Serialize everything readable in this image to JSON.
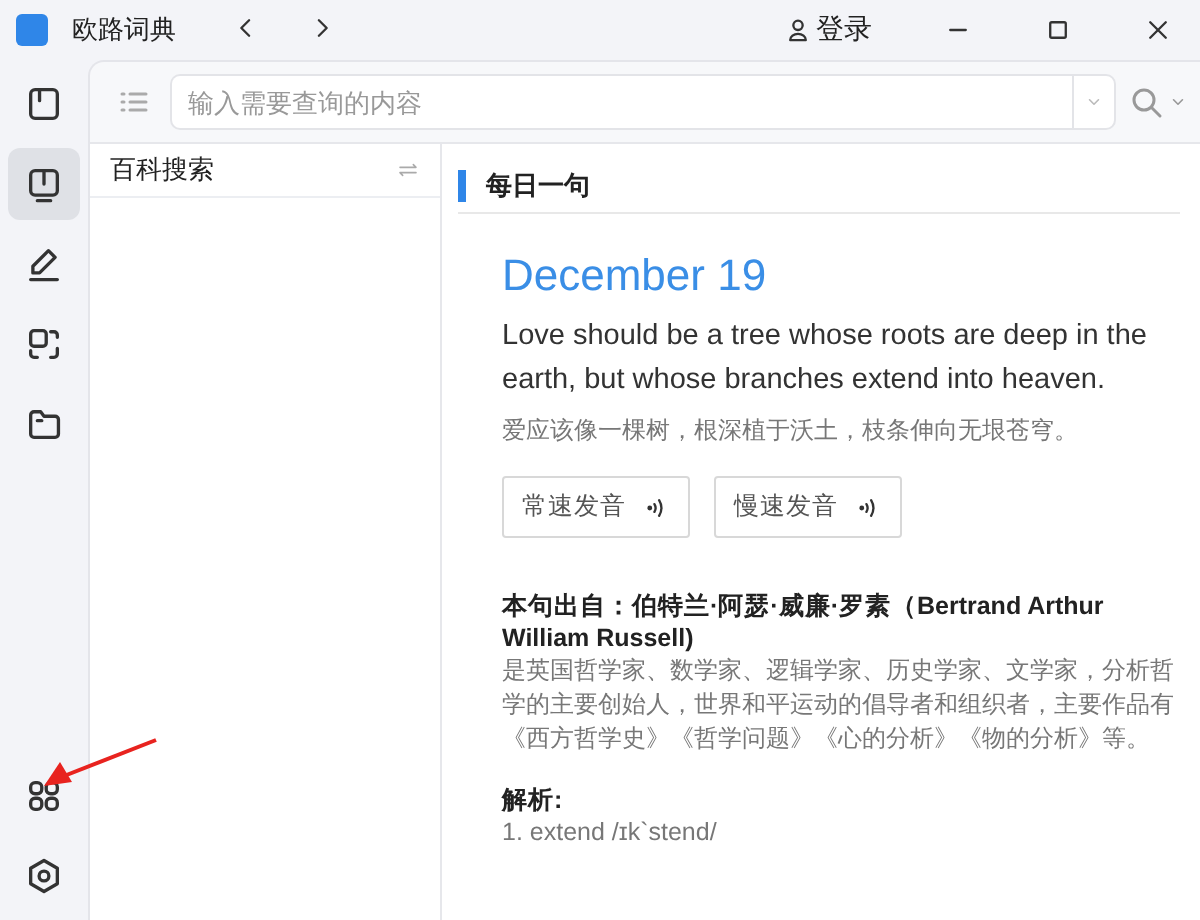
{
  "window": {
    "title": "欧路词典"
  },
  "account": {
    "label": "登录"
  },
  "sidebar": {
    "items": [
      {
        "kind": "book",
        "selected": false
      },
      {
        "kind": "reader",
        "selected": true
      },
      {
        "kind": "pen",
        "selected": false
      },
      {
        "kind": "scan",
        "selected": false
      },
      {
        "kind": "folder",
        "selected": false
      }
    ],
    "bottom_items": [
      {
        "kind": "grid",
        "selected": false
      },
      {
        "kind": "settings",
        "selected": false
      }
    ]
  },
  "search": {
    "placeholder": "输入需要查询的内容"
  },
  "left_panel": {
    "title": "百科搜索"
  },
  "daily": {
    "heading": "每日一句",
    "date": "December 19",
    "quote": "Love should be a tree whose roots are deep in the earth, but whose branches extend into heaven.",
    "translation": "爱应该像一棵树，根深植于沃土，枝条伸向无垠苍穹。",
    "buttons": [
      "常速发音",
      "慢速发音"
    ],
    "source": "本句出自：伯特兰·阿瑟·威廉·罗素（Bertrand Arthur William Russell)",
    "description": "是英国哲学家、数学家、逻辑学家、历史学家、文学家，分析哲学的主要创始人，世界和平运动的倡导者和组织者，主要作品有《西方哲学史》《哲学问题》《心的分析》《物的分析》等。",
    "analysis_heading": "解析:",
    "analysis_line": "1. extend /ɪk`stend/"
  }
}
